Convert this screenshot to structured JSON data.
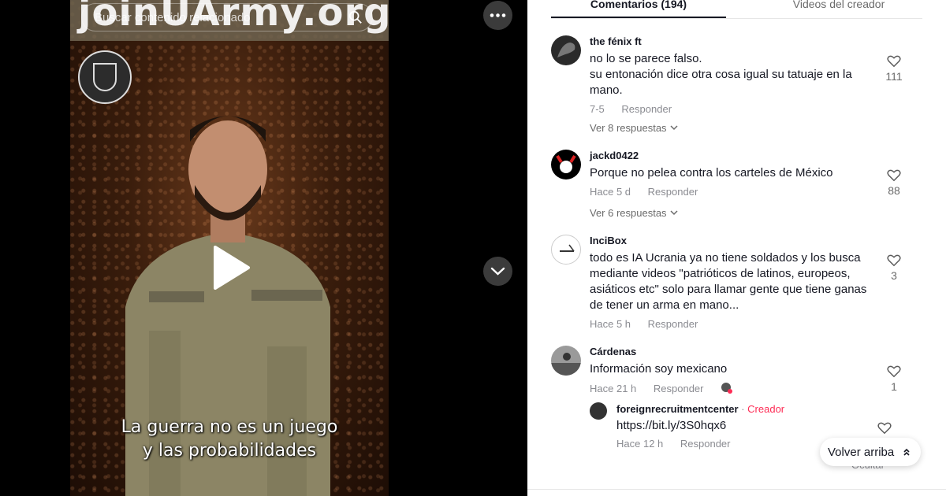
{
  "video": {
    "watermark": "joinUArmy.org",
    "search_placeholder": "Buscar contenido relacionado",
    "caption_line1": "La guerra no es un juego",
    "caption_line2": "y las probabilidades",
    "icons": {
      "more": "more-horizontal-icon",
      "down": "chevron-down-icon",
      "play": "play-icon",
      "search": "search-icon"
    }
  },
  "tabs": [
    {
      "label": "Comentarios (194)",
      "active": true
    },
    {
      "label": "Videos del creador",
      "active": false
    }
  ],
  "comments": [
    {
      "user": "the fénix ft",
      "text": "no lo se parece falso.\nsu entonación dice otra cosa igual su tatuaje en la mano.",
      "date": "7-5",
      "reply_label": "Responder",
      "likes": "111",
      "more_replies": "Ver 8 respuestas"
    },
    {
      "user": "jackd0422",
      "text": "Porque no pelea contra los carteles de México",
      "date": "Hace 5 d",
      "reply_label": "Responder",
      "likes": "88",
      "more_replies": "Ver 6 respuestas"
    },
    {
      "user": "InciBox",
      "text": "todo es IA Ucrania ya no tiene soldados y los busca mediante videos \"patrióticos de latinos, europeos, asiáticos etc\" solo para llamar gente que tiene ganas de tener un arma en mano...",
      "date": "Hace 5 h",
      "reply_label": "Responder",
      "likes": "3"
    },
    {
      "user": "Cárdenas",
      "text": "Información soy mexicano",
      "date": "Hace 21 h",
      "reply_label": "Responder",
      "likes": "1",
      "reply": {
        "user": "foreignrecruitmentcenter",
        "separator": " · ",
        "creator_tag": "Creador",
        "text": "https://bit.ly/3S0hqx6",
        "date": "Hace 12 h",
        "reply_label": "Responder"
      }
    }
  ],
  "scroll_top": {
    "label": "Volver arriba"
  },
  "ghost_text": "Ocultar",
  "colors": {
    "accent": "#fe2c55",
    "text": "#161823",
    "muted": "#8a8b91"
  }
}
